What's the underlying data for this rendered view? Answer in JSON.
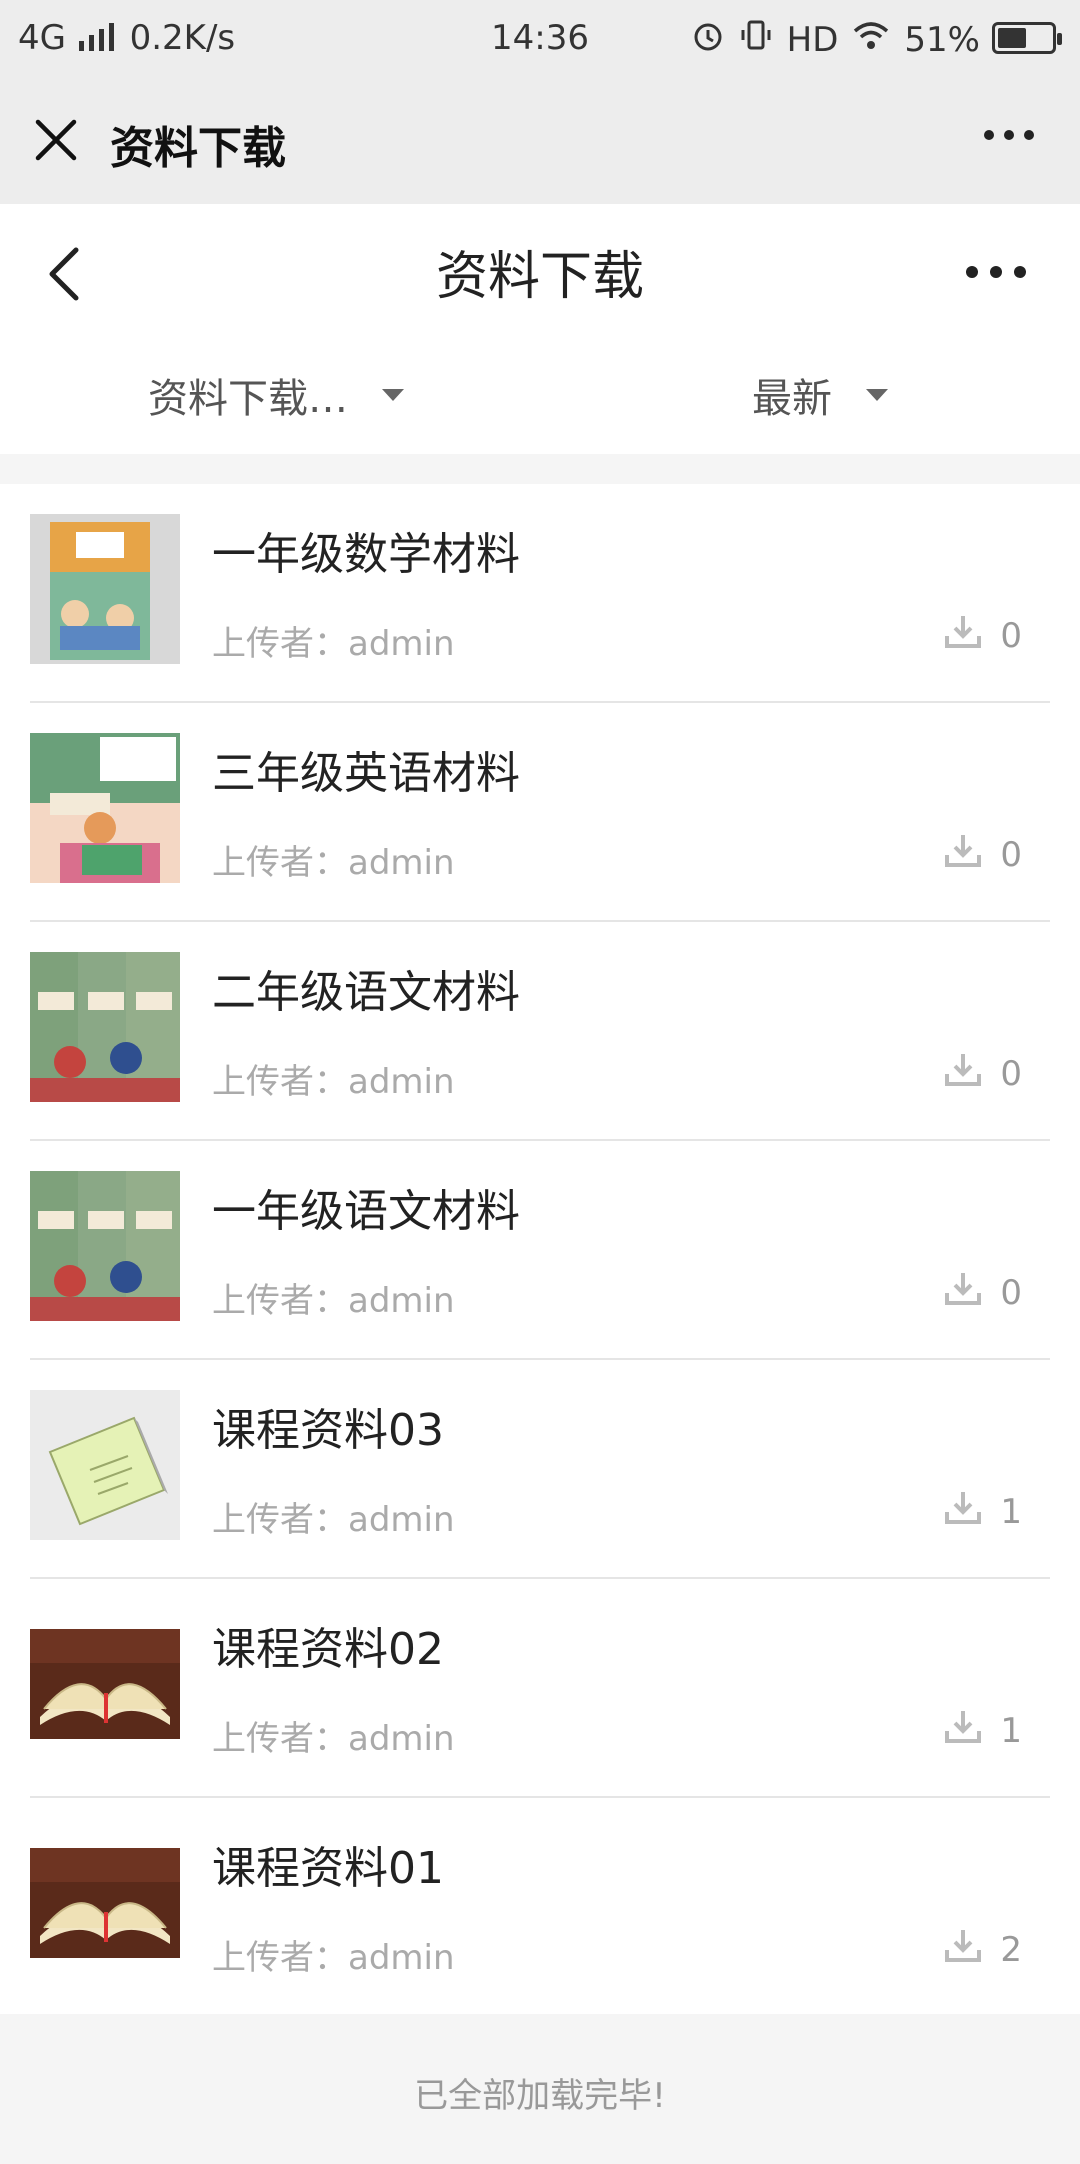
{
  "status_bar": {
    "network": "4G",
    "speed": "0.2K/s",
    "time": "14:36",
    "right_text": "HD",
    "battery": "51%"
  },
  "wechat_bar": {
    "title": "资料下载"
  },
  "page_header": {
    "title": "资料下载"
  },
  "filters": {
    "category": "资料下载…",
    "sort": "最新"
  },
  "items": [
    {
      "title": "一年级数学材料",
      "uploader": "上传者：admin",
      "downloads": "0",
      "thumb": "math-book"
    },
    {
      "title": "三年级英语材料",
      "uploader": "上传者：admin",
      "downloads": "0",
      "thumb": "english-book"
    },
    {
      "title": "二年级语文材料",
      "uploader": "上传者：admin",
      "downloads": "0",
      "thumb": "chinese-books"
    },
    {
      "title": "一年级语文材料",
      "uploader": "上传者：admin",
      "downloads": "0",
      "thumb": "chinese-books"
    },
    {
      "title": "课程资料03",
      "uploader": "上传者：admin",
      "downloads": "1",
      "thumb": "notebook"
    },
    {
      "title": "课程资料02",
      "uploader": "上传者：admin",
      "downloads": "1",
      "thumb": "open-book"
    },
    {
      "title": "课程资料01",
      "uploader": "上传者：admin",
      "downloads": "2",
      "thumb": "open-book"
    }
  ],
  "footer": {
    "text": "已全部加载完毕!"
  },
  "colors": {
    "bar_bg": "#ededed",
    "page_bg": "#f5f5f5",
    "muted": "#aaaaaa"
  }
}
